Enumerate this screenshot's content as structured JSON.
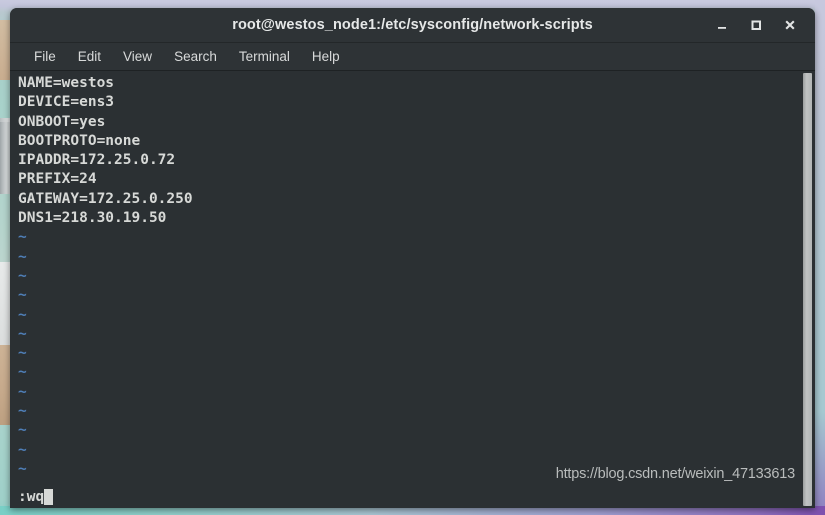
{
  "window": {
    "title": "root@westos_node1:/etc/sysconfig/network-scripts",
    "controls": {
      "minimize_label": "Minimize",
      "maximize_label": "Maximize",
      "close_label": "Close"
    }
  },
  "menubar": {
    "items": [
      {
        "label": "File"
      },
      {
        "label": "Edit"
      },
      {
        "label": "View"
      },
      {
        "label": "Search"
      },
      {
        "label": "Terminal"
      },
      {
        "label": "Help"
      }
    ]
  },
  "terminal": {
    "editor": "vim",
    "file_lines": [
      "NAME=westos",
      "DEVICE=ens3",
      "ONBOOT=yes",
      "BOOTPROTO=none",
      "IPADDR=172.25.0.72",
      "PREFIX=24",
      "GATEWAY=172.25.0.250",
      "DNS1=218.30.19.50"
    ],
    "empty_line_marker": "~",
    "empty_line_count": 14,
    "status_line": ":wq",
    "colors": {
      "background": "#2b3033",
      "foreground": "#d7d9d7",
      "tilde": "#4f7fb8",
      "titlebar": "#2e3336"
    }
  },
  "watermark": {
    "text": "https://blog.csdn.net/weixin_47133613"
  }
}
